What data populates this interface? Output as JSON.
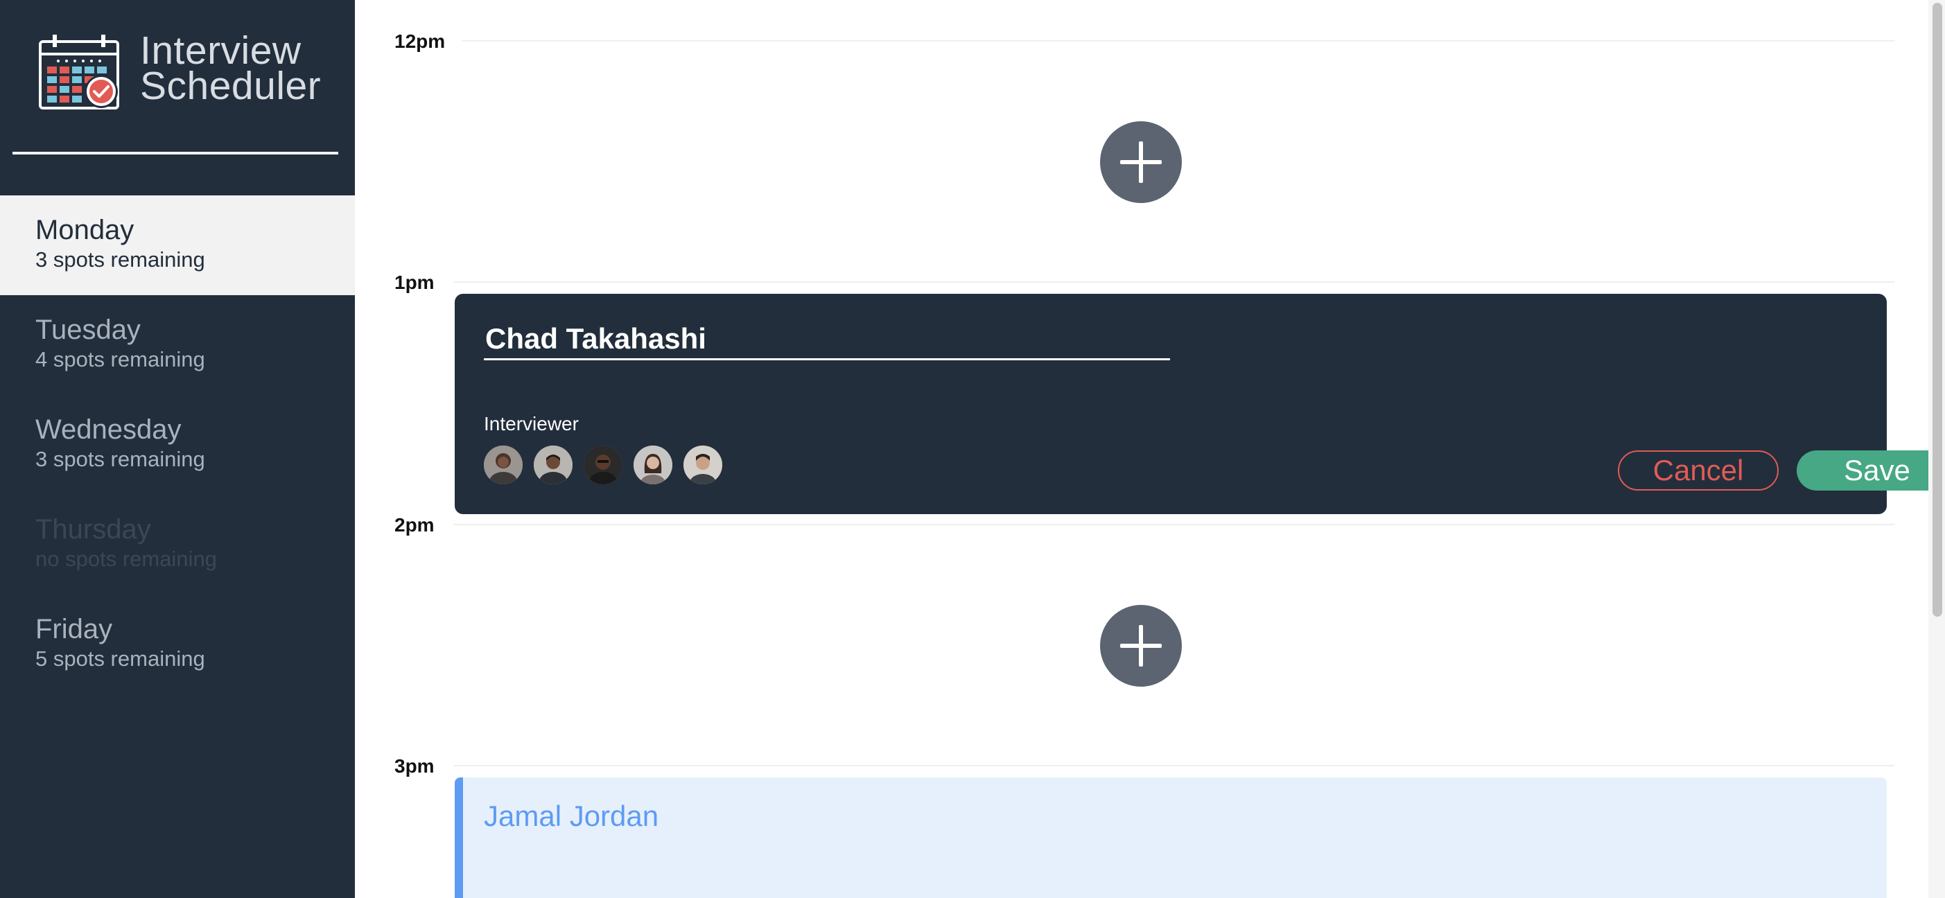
{
  "app": {
    "title_line1": "Interview",
    "title_line2": "Scheduler"
  },
  "sidebar": {
    "days": [
      {
        "name": "Monday",
        "spots": "3 spots remaining",
        "state": "selected"
      },
      {
        "name": "Tuesday",
        "spots": "4 spots remaining",
        "state": "normal"
      },
      {
        "name": "Wednesday",
        "spots": "3 spots remaining",
        "state": "normal"
      },
      {
        "name": "Thursday",
        "spots": "no spots remaining",
        "state": "full"
      },
      {
        "name": "Friday",
        "spots": "5 spots remaining",
        "state": "normal"
      }
    ]
  },
  "schedule": {
    "times": [
      "12pm",
      "1pm",
      "2pm",
      "3pm"
    ],
    "form": {
      "student_name": "Chad Takahashi",
      "interviewer_label": "Interviewer",
      "interviewers": [
        "interviewer-1",
        "interviewer-2",
        "interviewer-3",
        "interviewer-4",
        "interviewer-5"
      ],
      "cancel_label": "Cancel",
      "save_label": "Save"
    },
    "booked": {
      "student": "Jamal Jordan"
    }
  },
  "colors": {
    "sidebar_bg": "#222e3c",
    "selected_day_bg": "#f2f2f2",
    "cancel": "#e15b55",
    "save": "#46a885",
    "booked_accent": "#5e9bf2",
    "booked_bg": "#e6f0fd"
  },
  "icons": {
    "logo": "calendar-check-icon",
    "add": "plus-icon"
  }
}
